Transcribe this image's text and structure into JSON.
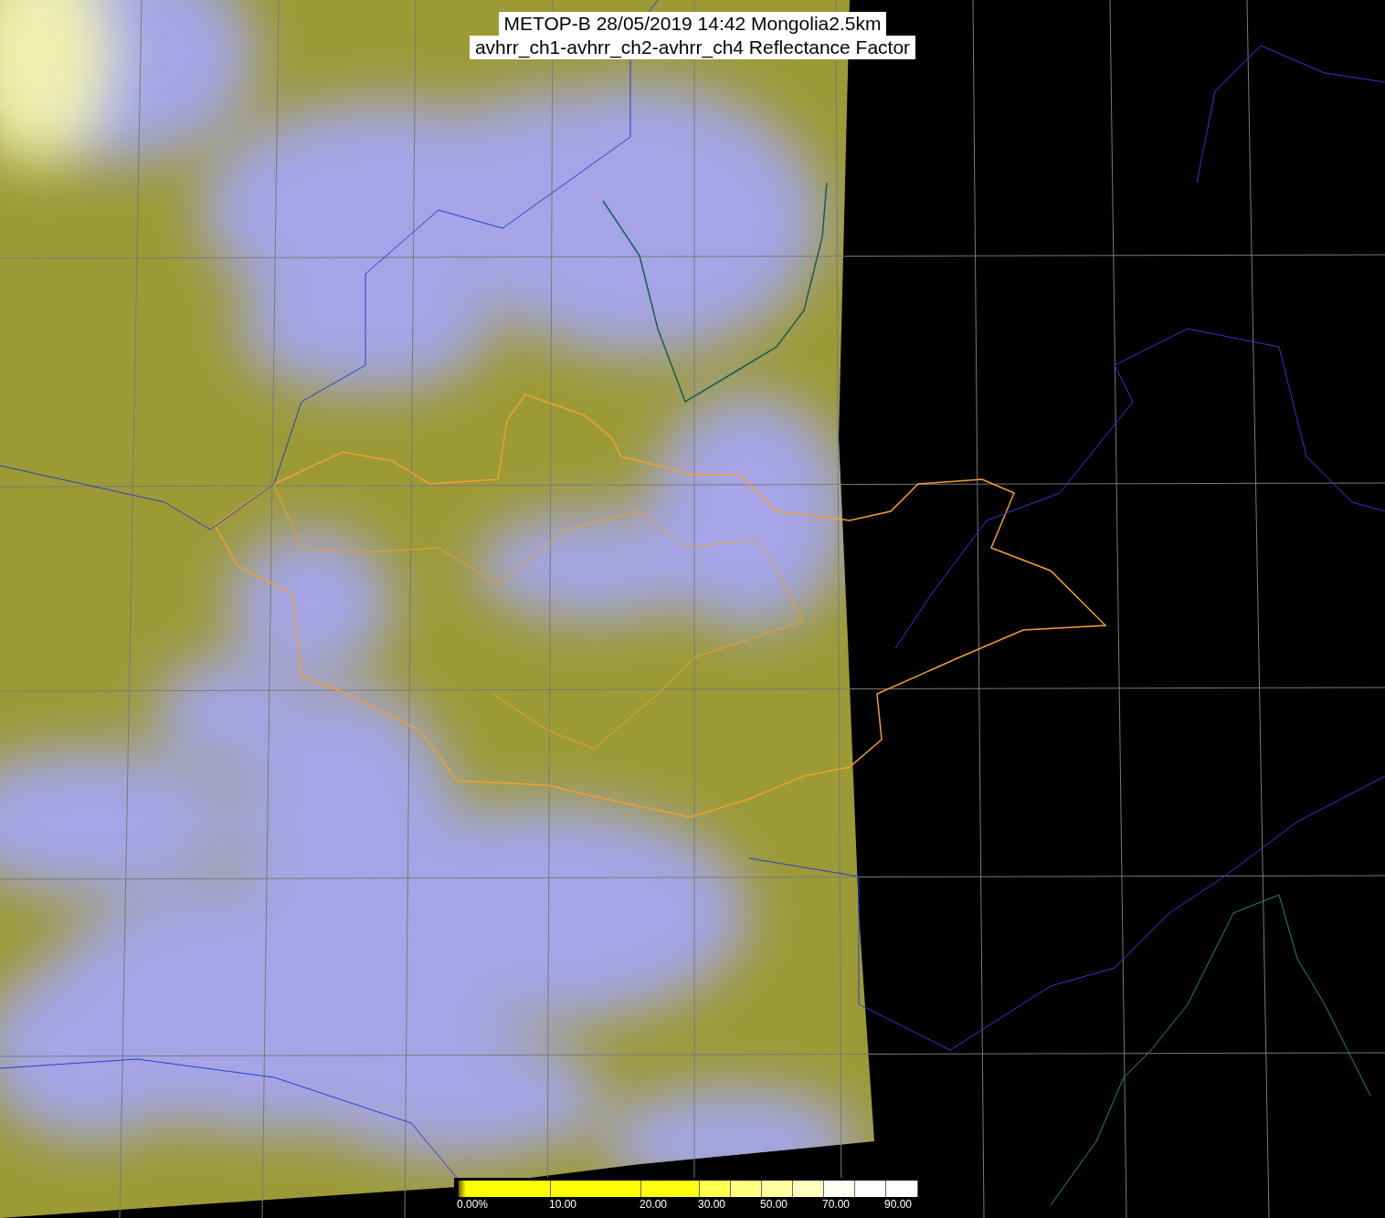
{
  "title": {
    "lines": [
      "METOP-B 28/05/2019 14:42 Mongolia2.5km",
      "avhrr_ch1-avhrr_ch2-avhrr_ch4 Reflectance Factor"
    ]
  },
  "legend": {
    "ticks": [
      "0.00%",
      "10.00",
      "20.00",
      "30.00",
      "50.00",
      "70.00",
      "90.00"
    ]
  }
}
